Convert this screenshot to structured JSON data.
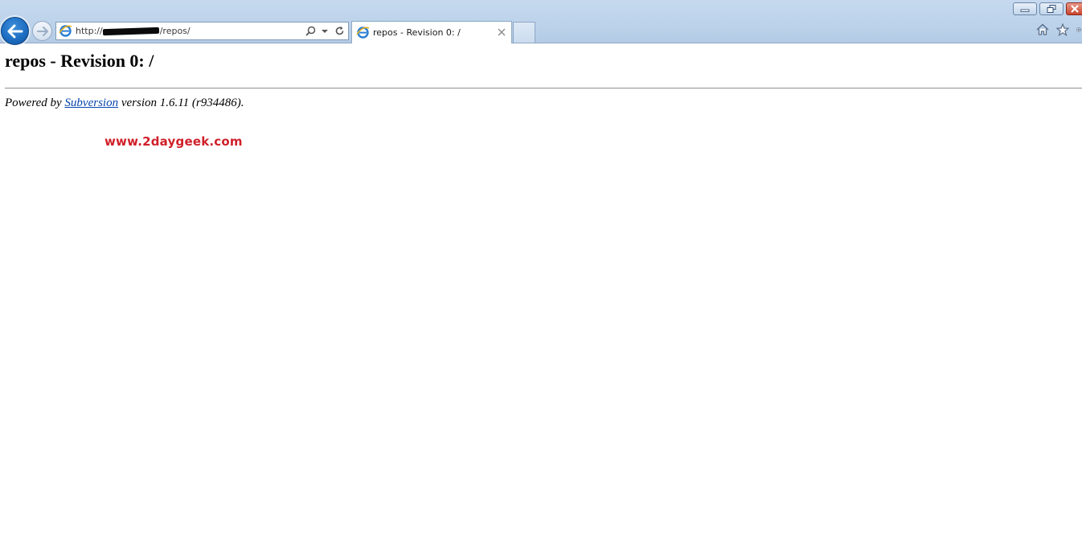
{
  "browser": {
    "address": {
      "prefix": "http://",
      "suffix": "/repos/"
    },
    "tab": {
      "title": "repos - Revision 0: /"
    }
  },
  "page": {
    "heading": "repos - Revision 0: /",
    "footer": {
      "prefix": "Powered by ",
      "link_text": "Subversion",
      "suffix": " version 1.6.11 (r934486)."
    },
    "watermark": "www.2daygeek.com"
  },
  "colors": {
    "link": "#0645ad",
    "watermark": "#d0202a",
    "back_button": "#1e6ec2"
  }
}
